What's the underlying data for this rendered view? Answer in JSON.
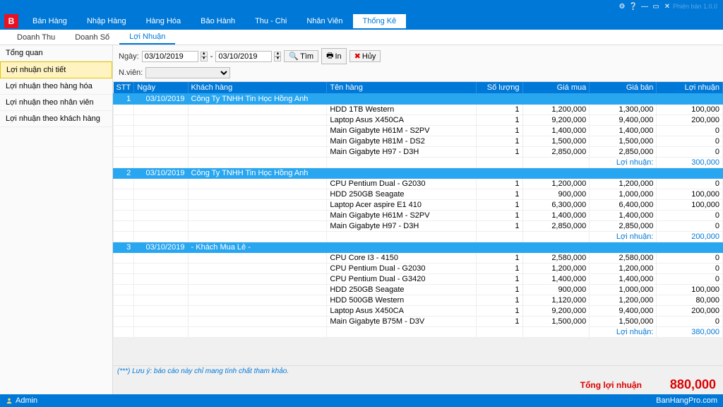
{
  "titlebar": {
    "version": "Phiên bản 1.0.0"
  },
  "main_tabs": [
    "Bán Hàng",
    "Nhập Hàng",
    "Hàng Hóa",
    "Bảo Hành",
    "Thu - Chi",
    "Nhân Viên",
    "Thống Kê"
  ],
  "main_active": 6,
  "sub_tabs": [
    "Doanh Thu",
    "Doanh Số",
    "Lợi Nhuận"
  ],
  "sub_active": 2,
  "sidebar": {
    "items": [
      "Tổng quan",
      "Lợi nhuận chi tiết",
      "Lợi nhuận theo hàng hóa",
      "Lợi nhuận theo nhân viên",
      "Lợi nhuận theo khách hàng"
    ],
    "active": 1
  },
  "filters": {
    "label_date": "Ngày:",
    "date_from": "03/10/2019",
    "date_to": "03/10/2019",
    "label_emp": "N.viên:",
    "emp": "",
    "btn_find": "Tìm",
    "btn_print": "In",
    "btn_cancel": "Hủy"
  },
  "columns": {
    "stt": "STT",
    "date": "Ngày",
    "cust": "Khách hàng",
    "prod": "Tên hàng",
    "qty": "Số lượng",
    "buy": "Giá mua",
    "sell": "Giá bán",
    "prof": "Lợi nhuận"
  },
  "subtotal_label": "Lợi nhuận:",
  "groups": [
    {
      "stt": "1",
      "date": "03/10/2019",
      "cust": "Công Ty TNHH Tin Học Hồng Anh",
      "rows": [
        {
          "prod": "HDD 1TB Western",
          "qty": "1",
          "buy": "1,200,000",
          "sell": "1,300,000",
          "prof": "100,000"
        },
        {
          "prod": "Laptop Asus X450CA",
          "qty": "1",
          "buy": "9,200,000",
          "sell": "9,400,000",
          "prof": "200,000"
        },
        {
          "prod": "Main Gigabyte H61M - S2PV",
          "qty": "1",
          "buy": "1,400,000",
          "sell": "1,400,000",
          "prof": "0"
        },
        {
          "prod": "Main Gigabyte H81M - DS2",
          "qty": "1",
          "buy": "1,500,000",
          "sell": "1,500,000",
          "prof": "0"
        },
        {
          "prod": "Main Gigabyte H97 - D3H",
          "qty": "1",
          "buy": "2,850,000",
          "sell": "2,850,000",
          "prof": "0"
        }
      ],
      "subtotal": "300,000"
    },
    {
      "stt": "2",
      "date": "03/10/2019",
      "cust": "Công Ty TNHH Tin Học Hồng Anh",
      "rows": [
        {
          "prod": "CPU Pentium Dual - G2030",
          "qty": "1",
          "buy": "1,200,000",
          "sell": "1,200,000",
          "prof": "0"
        },
        {
          "prod": "HDD 250GB Seagate",
          "qty": "1",
          "buy": "900,000",
          "sell": "1,000,000",
          "prof": "100,000"
        },
        {
          "prod": "Laptop Acer aspire E1 410",
          "qty": "1",
          "buy": "6,300,000",
          "sell": "6,400,000",
          "prof": "100,000"
        },
        {
          "prod": "Main Gigabyte H61M - S2PV",
          "qty": "1",
          "buy": "1,400,000",
          "sell": "1,400,000",
          "prof": "0"
        },
        {
          "prod": "Main Gigabyte H97 - D3H",
          "qty": "1",
          "buy": "2,850,000",
          "sell": "2,850,000",
          "prof": "0"
        }
      ],
      "subtotal": "200,000"
    },
    {
      "stt": "3",
      "date": "03/10/2019",
      "cust": "- Khách Mua Lẻ -",
      "rows": [
        {
          "prod": "CPU Core I3 - 4150",
          "qty": "1",
          "buy": "2,580,000",
          "sell": "2,580,000",
          "prof": "0"
        },
        {
          "prod": "CPU Pentium Dual - G2030",
          "qty": "1",
          "buy": "1,200,000",
          "sell": "1,200,000",
          "prof": "0"
        },
        {
          "prod": "CPU Pentium Dual - G3420",
          "qty": "1",
          "buy": "1,400,000",
          "sell": "1,400,000",
          "prof": "0"
        },
        {
          "prod": "HDD 250GB Seagate",
          "qty": "1",
          "buy": "900,000",
          "sell": "1,000,000",
          "prof": "100,000"
        },
        {
          "prod": "HDD 500GB Western",
          "qty": "1",
          "buy": "1,120,000",
          "sell": "1,200,000",
          "prof": "80,000"
        },
        {
          "prod": "Laptop Asus X450CA",
          "qty": "1",
          "buy": "9,200,000",
          "sell": "9,400,000",
          "prof": "200,000"
        },
        {
          "prod": "Main Gigabyte B75M - D3V",
          "qty": "1",
          "buy": "1,500,000",
          "sell": "1,500,000",
          "prof": "0"
        }
      ],
      "subtotal": "380,000"
    }
  ],
  "note": "(***) Lưu ý: báo cáo này chỉ mang tính chất tham khảo.",
  "total": {
    "label": "Tổng lợi nhuận",
    "value": "880,000"
  },
  "status": {
    "user": "Admin",
    "site": "BanHangPro.com"
  }
}
